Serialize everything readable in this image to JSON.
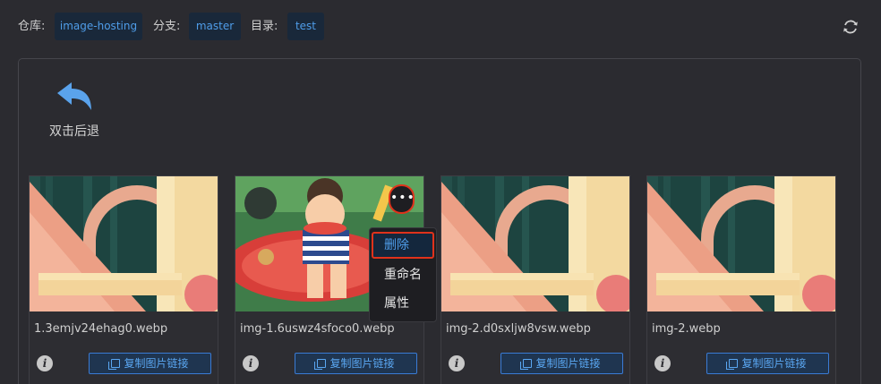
{
  "topbar": {
    "repo_label": "仓库:",
    "repo": "image-hosting",
    "branch_label": "分支:",
    "branch": "master",
    "dir_label": "目录:",
    "dir": "test"
  },
  "back_label": "双击后退",
  "cards": [
    {
      "filename": "1.3emjv24ehag0.webp",
      "copy_label": "复制图片链接"
    },
    {
      "filename": "img-1.6uswz4sfoco0.webp",
      "copy_label": "复制图片链接"
    },
    {
      "filename": "img-2.d0sxljw8vsw.webp",
      "copy_label": "复制图片链接"
    },
    {
      "filename": "img-2.webp",
      "copy_label": "复制图片链接"
    }
  ],
  "info_glyph": "i",
  "more_glyph": "•••",
  "context_menu": {
    "items": [
      "删除",
      "重命名",
      "属性"
    ]
  },
  "colors": {
    "accent": "#4f9de9",
    "highlight": "#e0321b",
    "background": "#2b2b30"
  },
  "icons": [
    "refresh-icon",
    "back-arrow-icon",
    "info-icon",
    "copy-icon",
    "more-icon"
  ]
}
